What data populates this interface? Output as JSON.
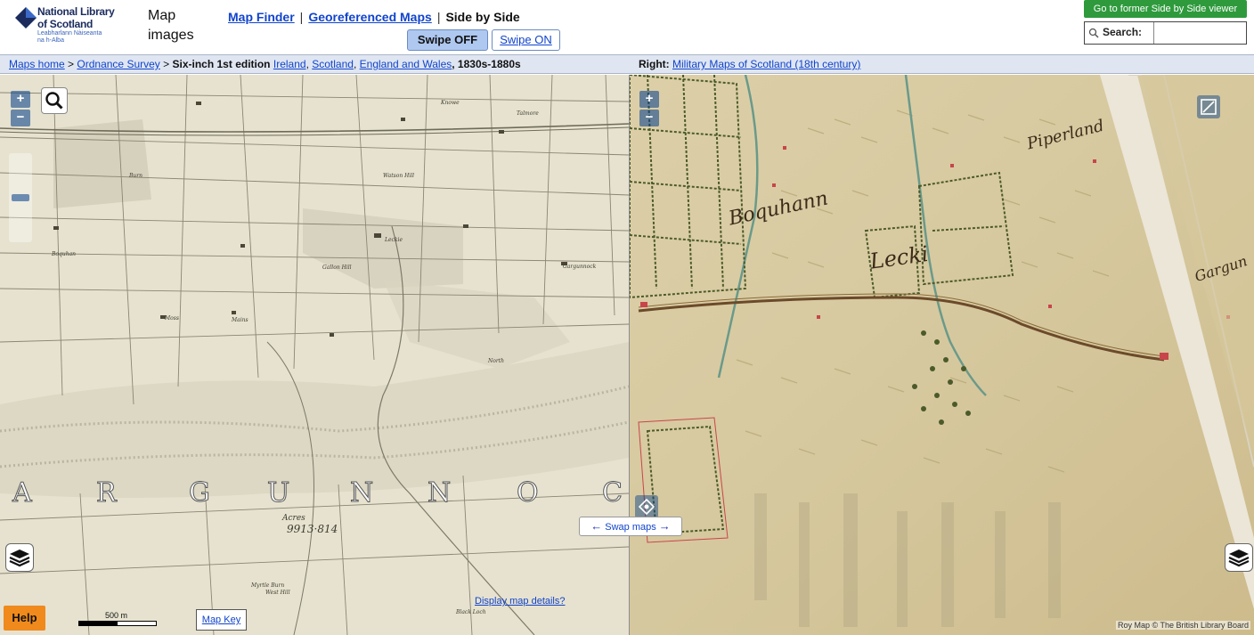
{
  "logo": {
    "line1": "National Library",
    "line2": "of Scotland",
    "gaelic1": "Leabharlann Nàiseanta",
    "gaelic2": "na h-Alba",
    "brand_color": "#1b2b5e"
  },
  "app_title": "Map images",
  "topnav": {
    "map_finder": "Map Finder",
    "georeferenced": "Georeferenced Maps",
    "separator": "|",
    "current": "Side by Side"
  },
  "swipe": {
    "off_label": "Swipe OFF",
    "on_label": "Swipe ON",
    "selected": "Swipe OFF"
  },
  "former_viewer_label": "Go to former Side by Side viewer",
  "search": {
    "label": "Search:",
    "value": "",
    "placeholder": ""
  },
  "breadcrumb_left": {
    "maps_home": "Maps home",
    "arrow1": ">",
    "ordnance_survey": "Ordnance Survey",
    "arrow2": ">",
    "series": "Six-inch 1st edition",
    "ireland": "Ireland",
    "comma1": ",",
    "scotland": "Scotland",
    "comma2": ",",
    "england_wales": "England and Wales",
    "dates": ", 1830s-1880s"
  },
  "breadcrumb_right": {
    "prefix": "Right:",
    "link": "Military Maps of Scotland (18th century)"
  },
  "left_map": {
    "large_letters": [
      "A",
      "R",
      "G",
      "U",
      "N",
      "N",
      "O",
      "C"
    ],
    "acres_label": "Acres",
    "acres_value": "9913·814",
    "help_label": "Help",
    "scale_label": "500 m",
    "map_key_label": "Map Key",
    "zoom_in": "+",
    "zoom_out": "−",
    "place_labels": [
      "Gargunnock",
      "Boquhan",
      "Leckie",
      "Gallon Hill",
      "Moss",
      "Burn",
      "Mains",
      "Knowe",
      "North",
      "West Hill",
      "Black Loch",
      "Talmore",
      "Myrtle Burn",
      "Watson Hill"
    ]
  },
  "right_map": {
    "labels": [
      "Boquhann",
      "Lecki",
      "Piperland",
      "Gargun"
    ],
    "zoom_in": "+",
    "zoom_out": "−",
    "attribution": "Roy Map © The British Library Board"
  },
  "display_details_label": "Display map details?",
  "swap_label": "Swap maps",
  "colors": {
    "accent_link": "#1144cc",
    "green_button": "#2e9a3c",
    "help_orange": "#f08a1c",
    "swipe_selected": "#aec8f0",
    "crumb_bg": "#dfe6f2"
  }
}
